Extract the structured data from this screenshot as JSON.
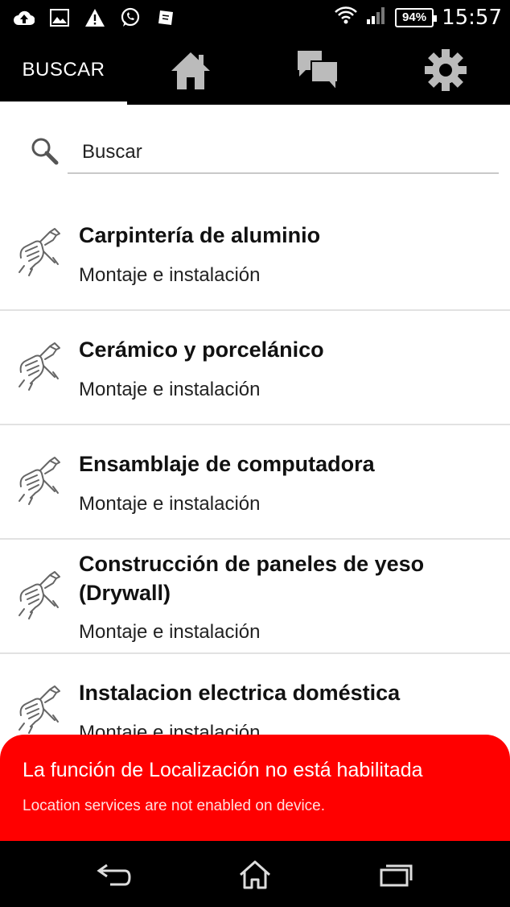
{
  "status_bar": {
    "battery": "94%",
    "time": "15:57",
    "left_icons": [
      "cloud-upload-icon",
      "image-icon",
      "warning-icon",
      "whatsapp-icon",
      "app-icon"
    ],
    "right_icons": [
      "wifi-icon",
      "signal-icon",
      "battery-icon"
    ]
  },
  "top_nav": {
    "tabs": [
      {
        "label": "BUSCAR",
        "icon": null,
        "selected": true
      },
      {
        "label": "",
        "icon": "home-icon"
      },
      {
        "label": "",
        "icon": "chat-icon"
      },
      {
        "label": "",
        "icon": "gear-icon"
      }
    ]
  },
  "search": {
    "placeholder": "Buscar",
    "value": ""
  },
  "list": {
    "items": [
      {
        "title": "Carpintería de aluminio",
        "subtitle": "Montaje e instalación",
        "icon": "tools-hand-icon"
      },
      {
        "title": "Cerámico y porcelánico",
        "subtitle": "Montaje e instalación",
        "icon": "tools-hand-icon"
      },
      {
        "title": "Ensamblaje de computadora",
        "subtitle": "Montaje e instalación",
        "icon": "tools-hand-icon"
      },
      {
        "title": "Construcción de paneles de yeso (Drywall)",
        "subtitle": "Montaje e instalación",
        "icon": "tools-hand-icon"
      },
      {
        "title": "Instalacion electrica doméstica",
        "subtitle": "Montaje e instalación",
        "icon": "tools-hand-icon"
      }
    ]
  },
  "toast": {
    "message": "La función de Localización no está habilitada",
    "detail": "Location services are not enabled on device.",
    "color": "#ff0000"
  },
  "nav_bar": {
    "buttons": [
      "back-icon",
      "home-icon",
      "recent-apps-icon"
    ]
  }
}
